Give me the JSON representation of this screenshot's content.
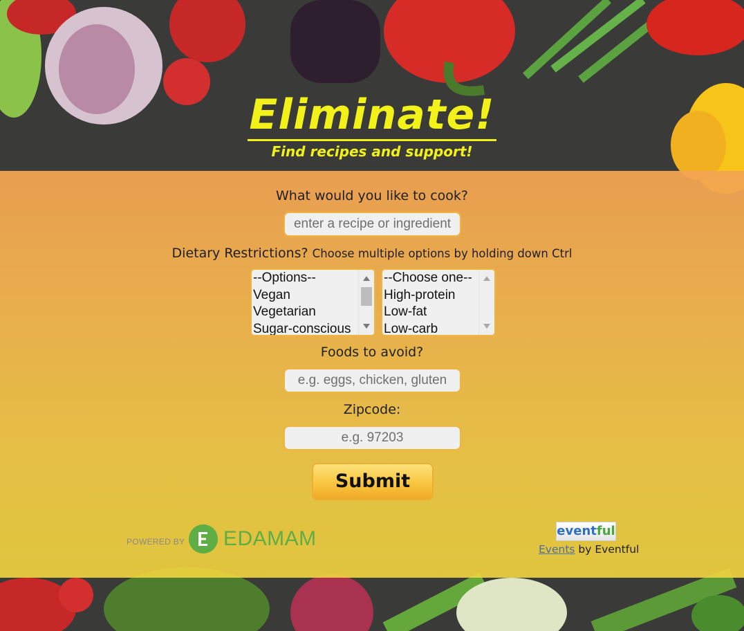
{
  "header": {
    "title": "Eliminate!",
    "subtitle": "Find recipes and support!"
  },
  "form": {
    "cook_label": "What would you like to cook?",
    "cook_placeholder": "enter a recipe or ingredient",
    "diet_label": "Dietary Restrictions?",
    "diet_hint": "Choose multiple options by holding down Ctrl",
    "options_list": [
      "--Options--",
      "Vegan",
      "Vegetarian",
      "Sugar-conscious"
    ],
    "choose_list": [
      "--Choose one--",
      "High-protein",
      "Low-fat",
      "Low-carb"
    ],
    "avoid_label": "Foods to avoid?",
    "avoid_placeholder": "e.g. eggs, chicken, gluten",
    "zip_label": "Zipcode:",
    "zip_placeholder": "e.g. 97203",
    "submit_label": "Submit"
  },
  "footer": {
    "edamam_powered": "POWERED BY",
    "edamam_brand": "EDAMAM",
    "eventful_logo_a": "event",
    "eventful_logo_b": "ful",
    "events_link": "Events",
    "events_by": " by Eventful"
  },
  "colors": {
    "title": "#f2f21a",
    "panel_top": "#f4a452",
    "panel_bottom": "#f2d43e",
    "edamam_green": "#5fae45"
  }
}
